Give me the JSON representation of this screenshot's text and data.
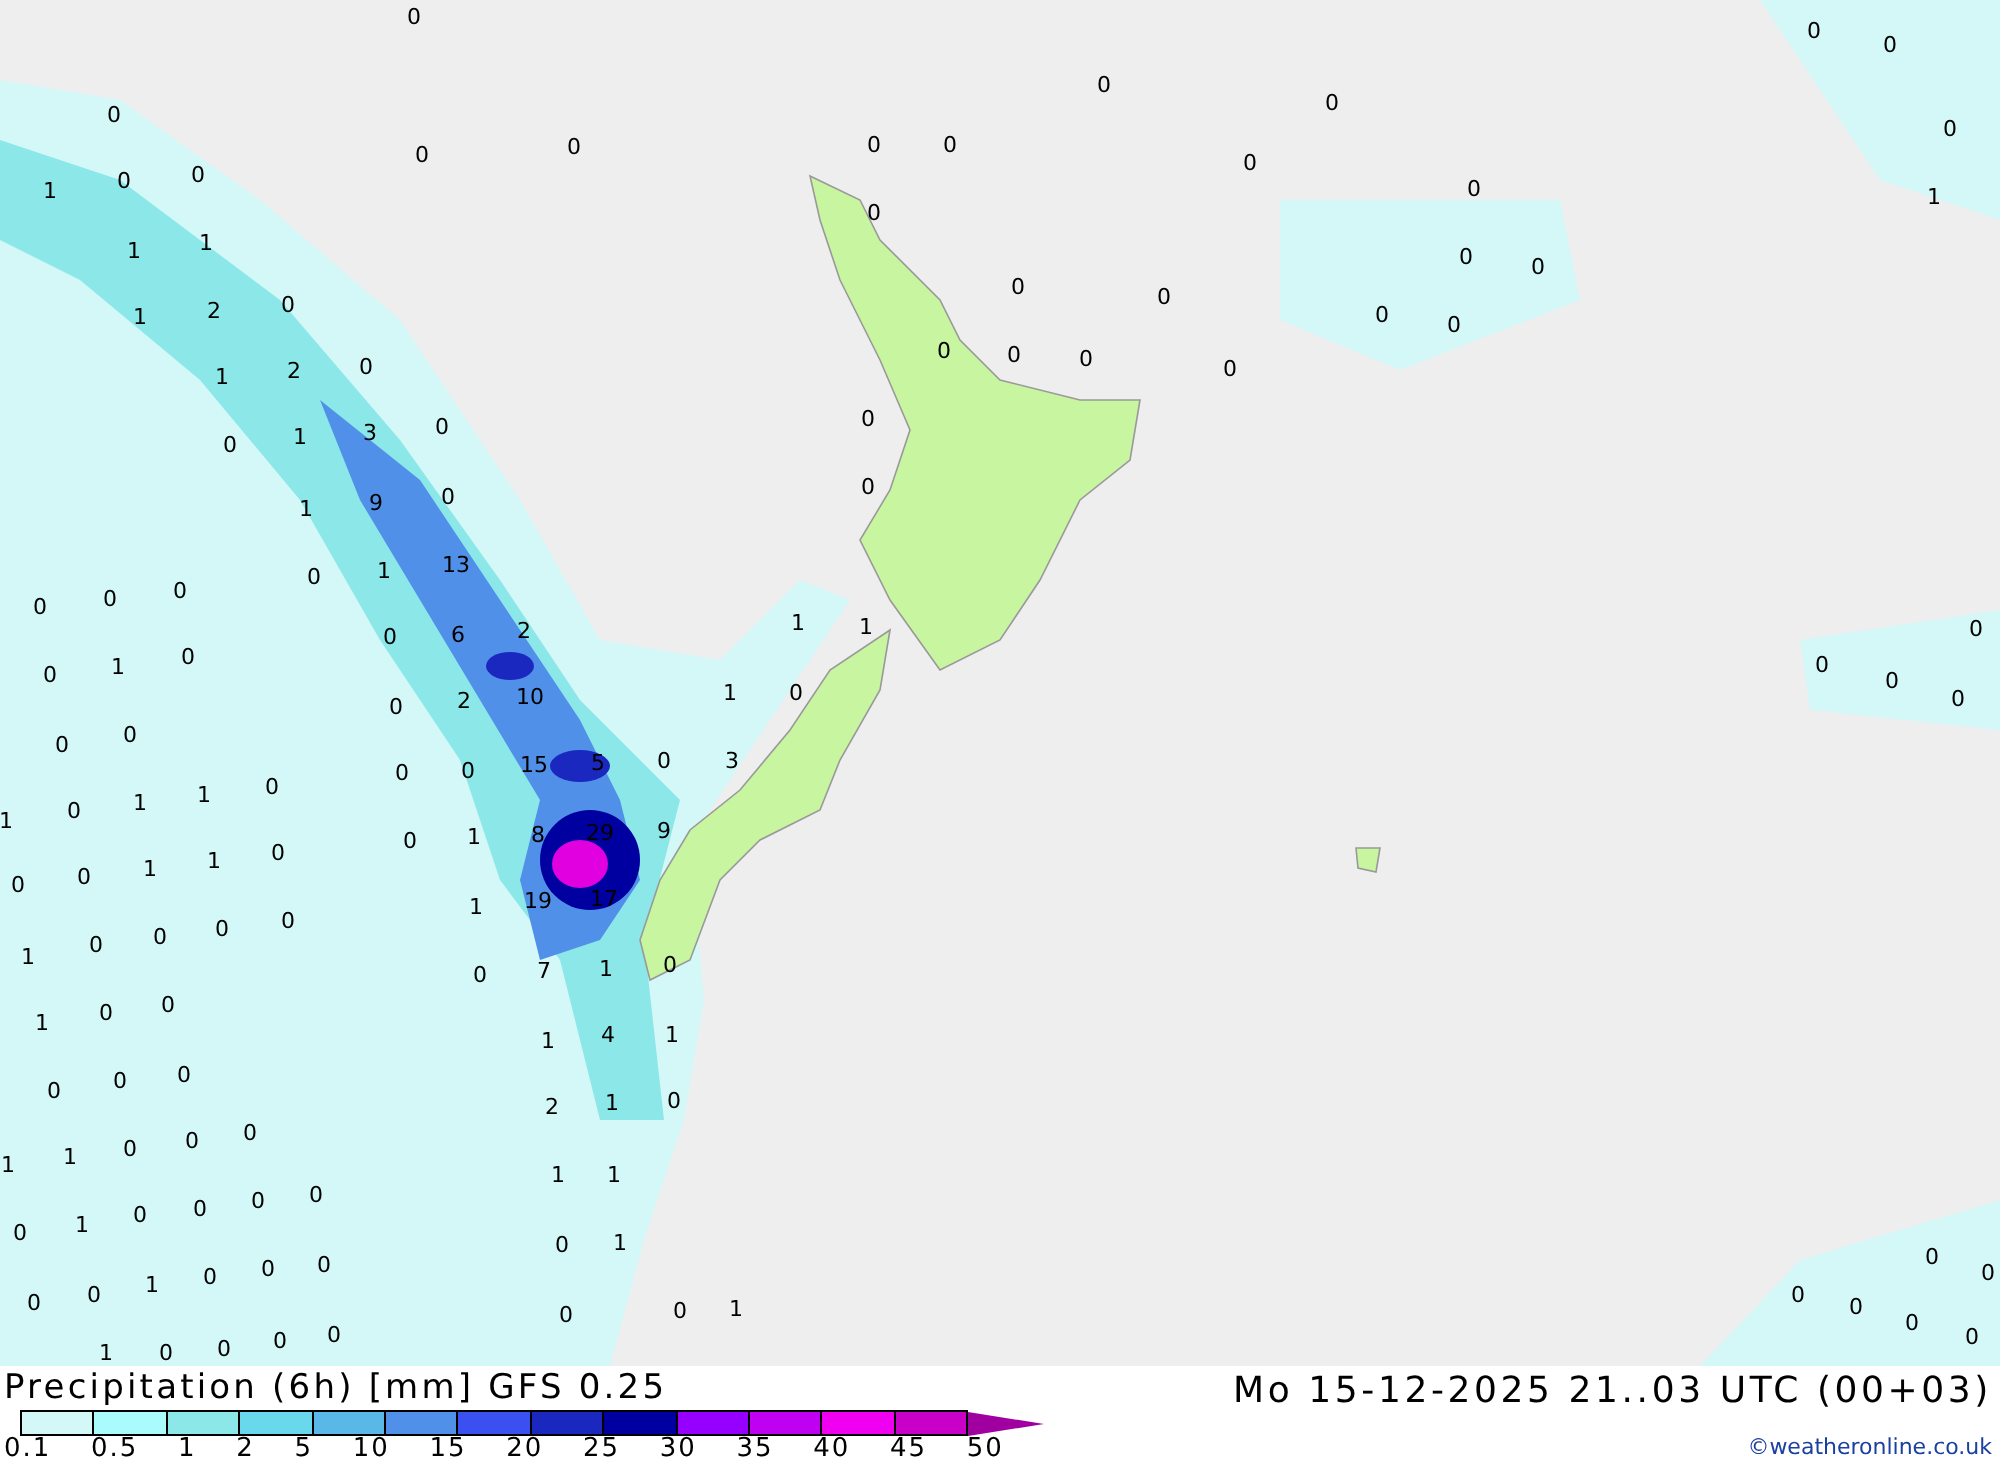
{
  "map": {
    "labels": [
      "0",
      "0",
      "0",
      "0",
      "1",
      "0",
      "0",
      "1",
      "1",
      "0",
      "1",
      "2",
      "1",
      "2",
      "0",
      "0",
      "1",
      "3",
      "0",
      "1",
      "9",
      "0",
      "0",
      "1",
      "13",
      "0",
      "6",
      "2",
      "0",
      "0",
      "0",
      "0",
      "1",
      "0",
      "0",
      "2",
      "10",
      "0",
      "0",
      "0",
      "0",
      "15",
      "5",
      "0",
      "3",
      "1",
      "0",
      "1",
      "1",
      "0",
      "0",
      "1",
      "8",
      "29",
      "9",
      "0",
      "0",
      "1",
      "1",
      "0",
      "1",
      "19",
      "17",
      "1",
      "0",
      "0",
      "0",
      "0",
      "0",
      "7",
      "1",
      "0",
      "1",
      "0",
      "0",
      "1",
      "4",
      "1",
      "0",
      "0",
      "0",
      "2",
      "1",
      "0",
      "1",
      "1",
      "0",
      "0",
      "0",
      "1",
      "1",
      "0",
      "1",
      "0",
      "0",
      "0",
      "0",
      "0",
      "1",
      "0",
      "0",
      "1",
      "0",
      "0",
      "0",
      "0",
      "0",
      "1",
      "1",
      "0",
      "0",
      "0",
      "0",
      "0",
      "0",
      "0",
      "0",
      "0",
      "0",
      "0",
      "0",
      "0",
      "0",
      "0",
      "0",
      "0",
      "0",
      "0",
      "0",
      "0",
      "0",
      "0",
      "0",
      "0",
      "0",
      "1",
      "1",
      "1",
      "1",
      "0",
      "0",
      "0",
      "0",
      "0",
      "0",
      "0",
      "0",
      "0",
      "0",
      "0"
    ]
  },
  "legend": {
    "title": "Precipitation (6h) [mm] GFS 0.25",
    "bins": [
      {
        "color": "#d4f7f7"
      },
      {
        "color": "#aafcfc"
      },
      {
        "color": "#8ce8e8"
      },
      {
        "color": "#6ad8ec"
      },
      {
        "color": "#5ab8e8"
      },
      {
        "color": "#5090e8"
      },
      {
        "color": "#3a50f0"
      },
      {
        "color": "#1a28c0"
      },
      {
        "color": "#0000a0"
      },
      {
        "color": "#9600ff"
      },
      {
        "color": "#c000f0"
      },
      {
        "color": "#f000f0"
      },
      {
        "color": "#c800c8"
      },
      {
        "kind": "arrow",
        "color": "#a000a0"
      }
    ],
    "ticks": [
      "0.1",
      "0.5",
      "1",
      "2",
      "5",
      "10",
      "15",
      "20",
      "25",
      "30",
      "35",
      "40",
      "45",
      "50"
    ]
  },
  "valid_time": "Mo 15-12-2025 21..03 UTC (00+03)",
  "credit": "©weatheronline.co.uk"
}
